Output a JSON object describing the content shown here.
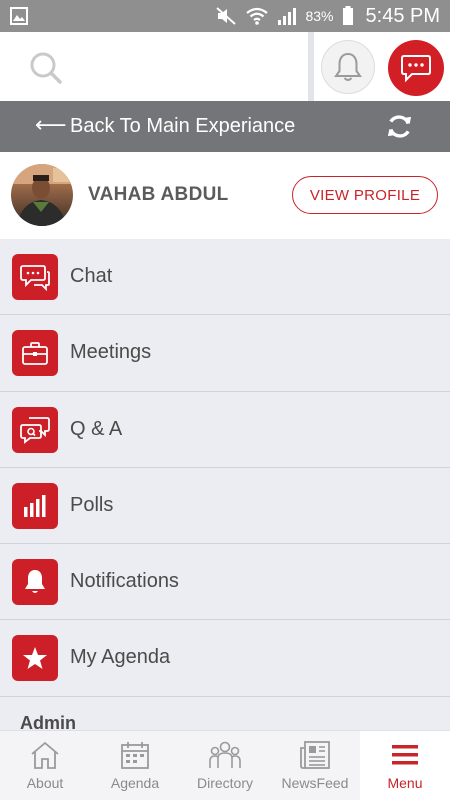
{
  "status_bar": {
    "battery": "83%",
    "time": "5:45 PM"
  },
  "back_bar": {
    "arrow": "⟵",
    "label": "Back To Main Experiance"
  },
  "profile": {
    "name": "VAHAB ABDUL",
    "view_profile": "VIEW PROFILE"
  },
  "menu": {
    "items": [
      {
        "label": "Chat",
        "icon": "chat-icon"
      },
      {
        "label": "Meetings",
        "icon": "briefcase-icon"
      },
      {
        "label": "Q & A",
        "icon": "qa-icon"
      },
      {
        "label": "Polls",
        "icon": "polls-icon"
      },
      {
        "label": "Notifications",
        "icon": "bell-icon"
      },
      {
        "label": "My Agenda",
        "icon": "star-icon"
      }
    ],
    "section_title": "Admin"
  },
  "bottom_nav": {
    "items": [
      {
        "label": "About",
        "icon": "home-icon"
      },
      {
        "label": "Agenda",
        "icon": "calendar-icon"
      },
      {
        "label": "Directory",
        "icon": "people-icon"
      },
      {
        "label": "NewsFeed",
        "icon": "newspaper-icon"
      },
      {
        "label": "Menu",
        "icon": "hamburger-icon"
      }
    ],
    "active": "Menu"
  },
  "colors": {
    "accent": "#cd1f27",
    "back_bar": "#747578",
    "menu_bg": "#ecedf2"
  }
}
